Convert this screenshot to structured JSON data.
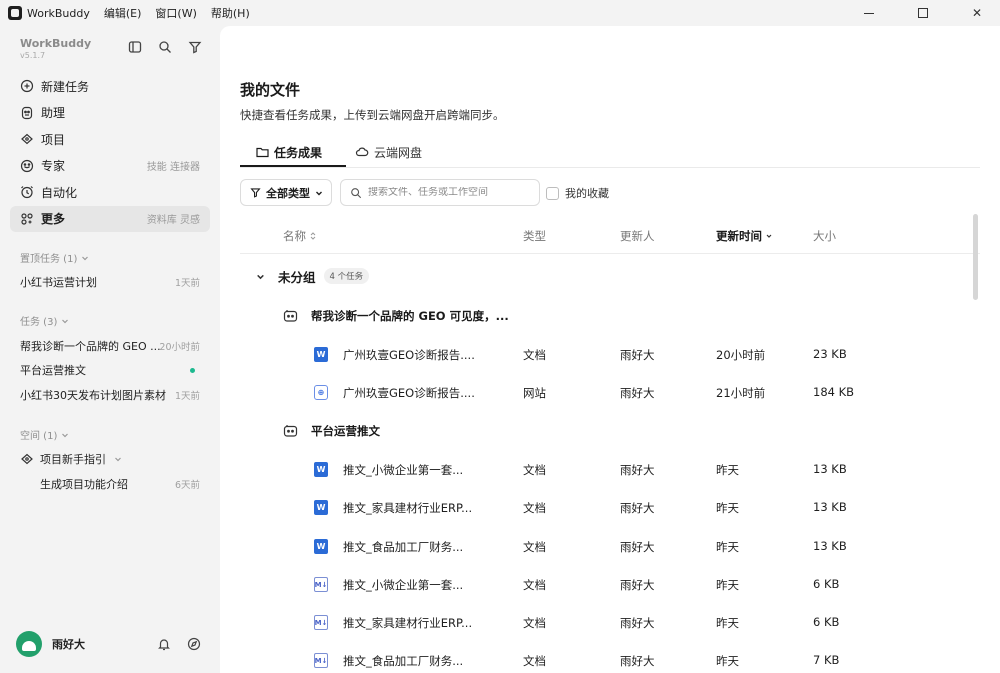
{
  "titlebar": {
    "app_name": "WorkBuddy",
    "menus": [
      "编辑(E)",
      "窗口(W)",
      "帮助(H)"
    ],
    "close_glyph": "✕"
  },
  "sidebar": {
    "brand_name": "WorkBuddy",
    "version": "v5.1.7",
    "nav": [
      {
        "label": "新建任务",
        "icon": "plus-circle-icon",
        "hint": ""
      },
      {
        "label": "助理",
        "icon": "assistant-icon",
        "hint": ""
      },
      {
        "label": "项目",
        "icon": "project-icon",
        "hint": ""
      },
      {
        "label": "专家",
        "icon": "expert-icon",
        "hint": "技能 连接器"
      },
      {
        "label": "自动化",
        "icon": "clock-icon",
        "hint": ""
      },
      {
        "label": "更多",
        "icon": "grid-icon",
        "hint": "资料库 灵感"
      }
    ],
    "pinned": {
      "header": "置顶任务 (1)",
      "items": [
        {
          "title": "小红书运营计划",
          "time": "1天前"
        }
      ]
    },
    "tasks": {
      "header": "任务 (3)",
      "items": [
        {
          "title": "帮我诊断一个品牌的 GEO ...",
          "time": "20小时前"
        },
        {
          "title": "平台运营推文",
          "time": ""
        },
        {
          "title": "小红书30天发布计划图片素材",
          "time": "1天前"
        }
      ]
    },
    "spaces": {
      "header": "空间 (1)",
      "project": "项目新手指引",
      "sub_item": {
        "title": "生成项目功能介绍",
        "time": "6天前"
      }
    },
    "user": {
      "name": "雨好大"
    }
  },
  "main": {
    "title": "我的文件",
    "subtitle": "快捷查看任务成果，上传到云端网盘开启跨端同步。",
    "tabs": [
      "任务成果",
      "云端网盘"
    ],
    "filter_label": "全部类型",
    "search_placeholder": "搜索文件、任务或工作空间",
    "favorites_label": "我的收藏",
    "columns": [
      "名称",
      "类型",
      "更新人",
      "更新时间",
      "大小"
    ],
    "group": {
      "name": "未分组",
      "badge": "4 个任务"
    },
    "task_groups": [
      {
        "title": "帮我诊断一个品牌的 GEO 可见度，...",
        "files": [
          {
            "kind": "word",
            "name": "广州玖壹GEO诊断报告....",
            "type": "文档",
            "updater": "雨好大",
            "time": "20小时前",
            "size": "23 KB"
          },
          {
            "kind": "web",
            "name": "广州玖壹GEO诊断报告....",
            "type": "网站",
            "updater": "雨好大",
            "time": "21小时前",
            "size": "184 KB"
          }
        ]
      },
      {
        "title": "平台运营推文",
        "files": [
          {
            "kind": "word",
            "name": "推文_小微企业第一套...",
            "type": "文档",
            "updater": "雨好大",
            "time": "昨天",
            "size": "13 KB"
          },
          {
            "kind": "word",
            "name": "推文_家具建材行业ERP...",
            "type": "文档",
            "updater": "雨好大",
            "time": "昨天",
            "size": "13 KB"
          },
          {
            "kind": "word",
            "name": "推文_食品加工厂财务...",
            "type": "文档",
            "updater": "雨好大",
            "time": "昨天",
            "size": "13 KB"
          },
          {
            "kind": "md",
            "name": "推文_小微企业第一套...",
            "type": "文档",
            "updater": "雨好大",
            "time": "昨天",
            "size": "6 KB"
          },
          {
            "kind": "md",
            "name": "推文_家具建材行业ERP...",
            "type": "文档",
            "updater": "雨好大",
            "time": "昨天",
            "size": "6 KB"
          },
          {
            "kind": "md",
            "name": "推文_食品加工厂财务...",
            "type": "文档",
            "updater": "雨好大",
            "time": "昨天",
            "size": "7 KB"
          }
        ]
      }
    ],
    "file_glyphs": {
      "word": "W",
      "web": "⊕",
      "md": "M↓"
    }
  }
}
